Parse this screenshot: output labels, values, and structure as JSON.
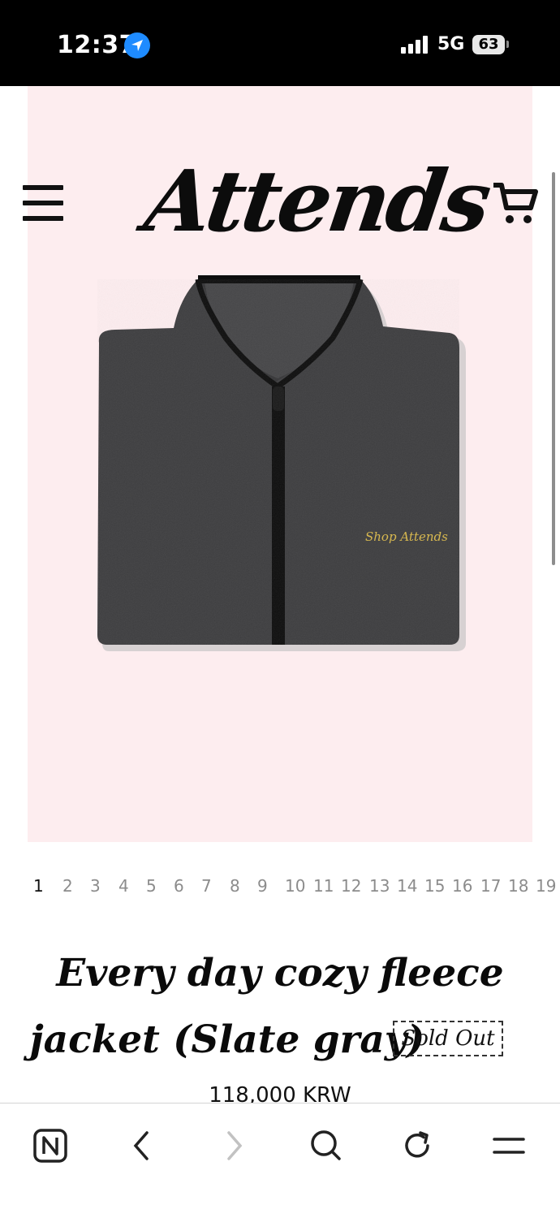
{
  "status_bar": {
    "time": "12:37",
    "network": "5G",
    "battery": "63"
  },
  "header": {
    "brand": "Attends"
  },
  "hero": {
    "embroidery": "Shop Attends"
  },
  "pagination": {
    "pages": [
      "1",
      "2",
      "3",
      "4",
      "5",
      "6",
      "7",
      "8",
      "9",
      "10",
      "11",
      "12",
      "13",
      "14",
      "15",
      "16",
      "17",
      "18",
      "19"
    ],
    "active_page": "1"
  },
  "product": {
    "title_line1": "Every day cozy fleece",
    "title_line2": "jacket (Slate gray)",
    "badge": "Sold Out",
    "price": "118,000 KRW"
  },
  "colors": {
    "hero_background": "#fdedef",
    "jacket": "#3d3d3f",
    "accent_location": "#1e8bff"
  },
  "icons": {
    "menu": "hamburger-icon",
    "cart": "cart-icon",
    "location": "location-arrow-icon",
    "toolbar": [
      "naver-home-icon",
      "back-icon",
      "forward-icon",
      "search-icon",
      "reload-icon",
      "menu-icon"
    ]
  }
}
